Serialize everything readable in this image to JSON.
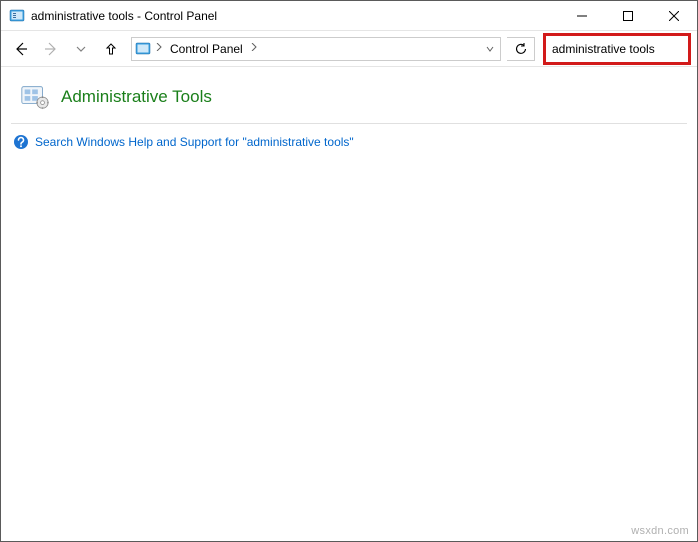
{
  "window": {
    "title": "administrative tools - Control Panel"
  },
  "nav": {
    "breadcrumb_root": "Control Panel"
  },
  "search": {
    "value": "administrative tools"
  },
  "result": {
    "heading": "Administrative Tools",
    "help_link": "Search Windows Help and Support for \"administrative tools\""
  },
  "watermark": "wsxdn.com"
}
